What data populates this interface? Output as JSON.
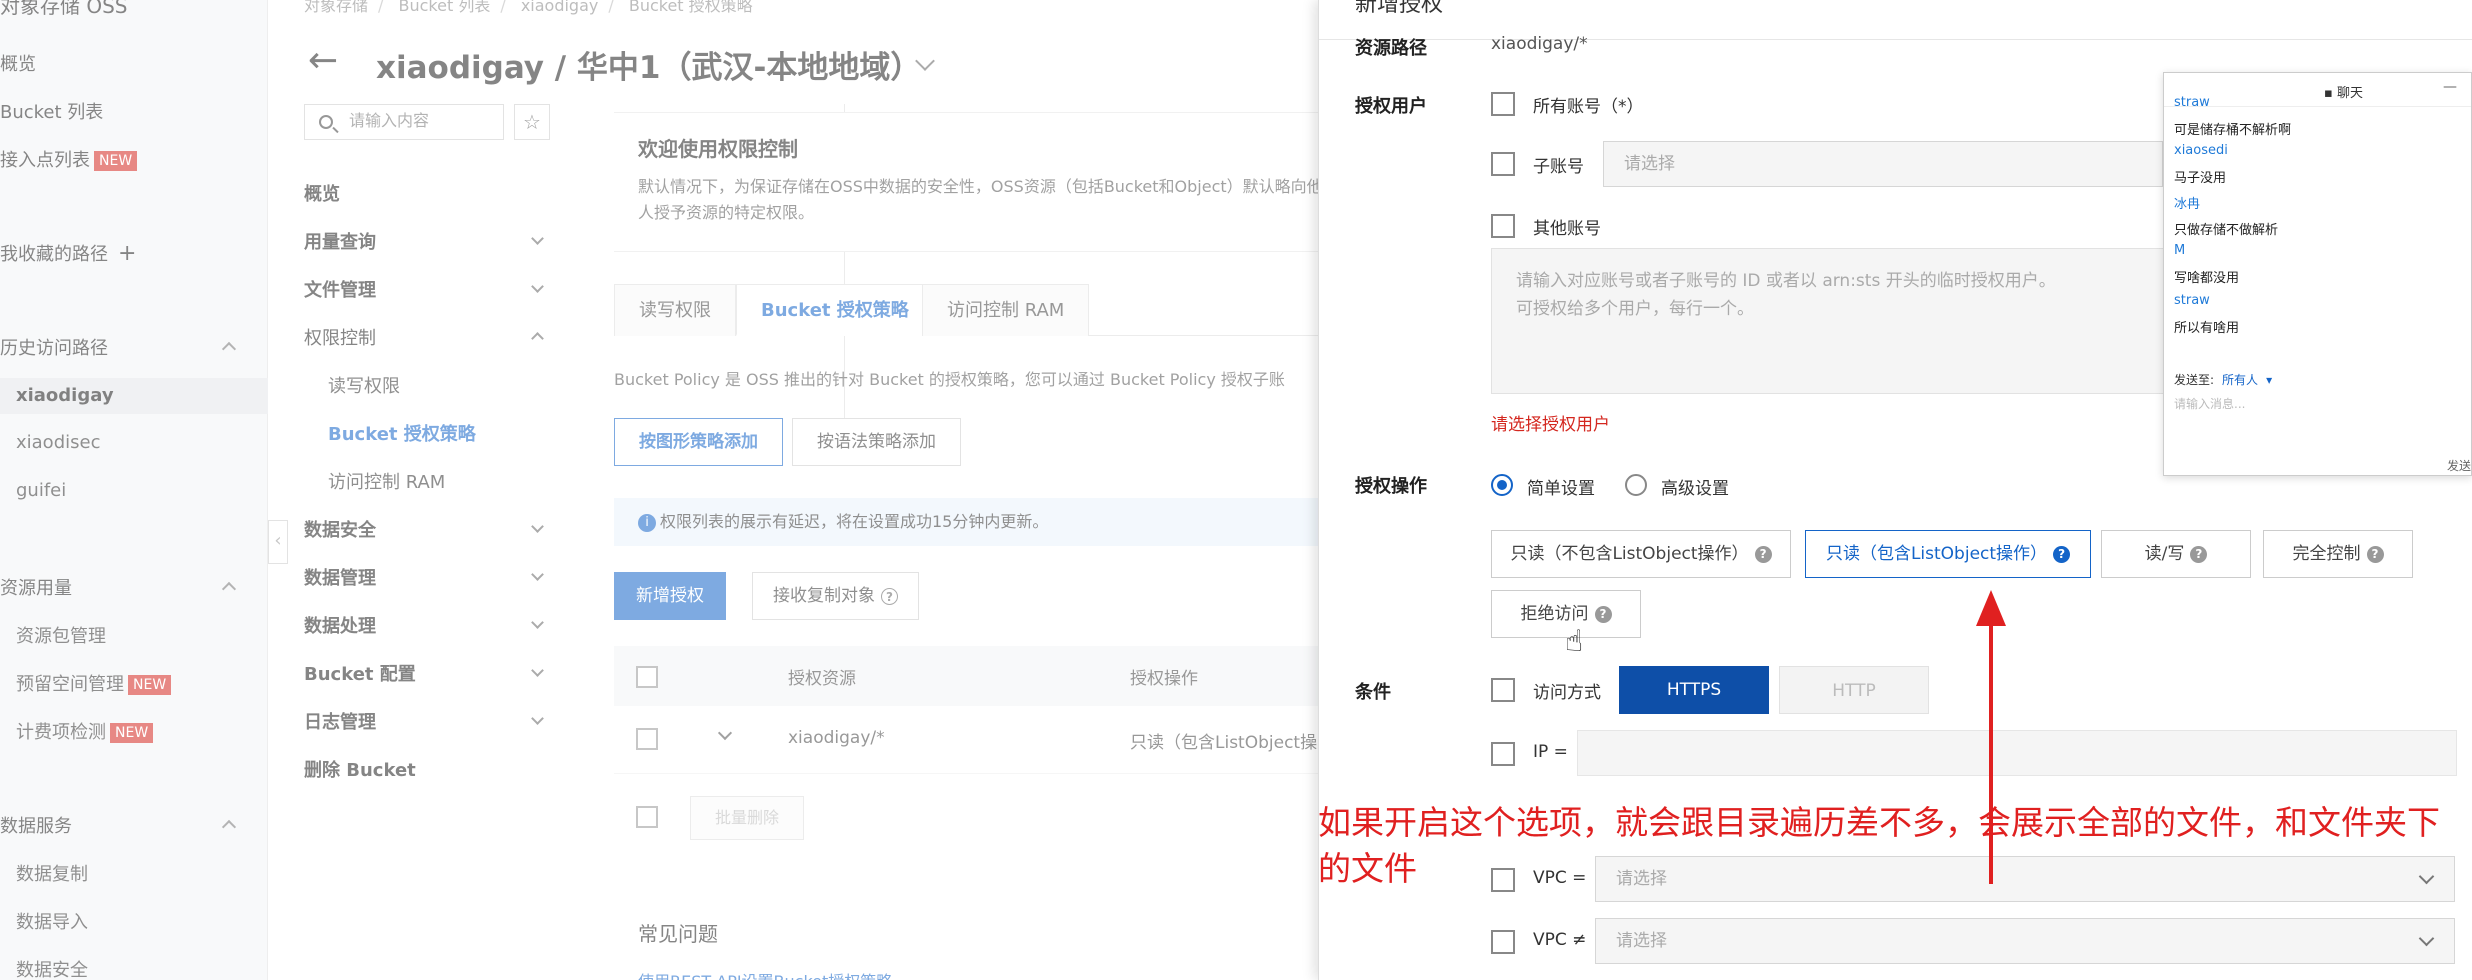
{
  "leftnav": {
    "title": "对象存储 OSS",
    "items": [
      {
        "label": "概览"
      },
      {
        "label": "Bucket 列表"
      },
      {
        "label": "接入点列表",
        "badge": "NEW"
      }
    ],
    "favorites_label": "我收藏的路径",
    "history_section": "历史访问路径",
    "history_items": [
      "xiaodigay",
      "xiaodisec",
      "guifei"
    ],
    "resource_section": "资源用量",
    "resource_items": [
      {
        "label": "资源包管理"
      },
      {
        "label": "预留空间管理",
        "badge": "NEW"
      },
      {
        "label": "计费项检测",
        "badge": "NEW"
      }
    ],
    "data_service_section": "数据服务",
    "data_service_items": [
      "数据复制",
      "数据导入",
      "数据安全"
    ]
  },
  "breadcrumb": [
    "对象存储",
    "Bucket 列表",
    "xiaodigay",
    "Bucket 授权策略"
  ],
  "page_title": "xiaodigay / 华中1（武汉-本地地域）",
  "subnav": {
    "search_placeholder": "请输入内容",
    "items": [
      {
        "label": "概览",
        "chev": false
      },
      {
        "label": "用量查询",
        "chev": true
      },
      {
        "label": "文件管理",
        "chev": true
      },
      {
        "label": "权限控制",
        "chev": true,
        "open": true
      }
    ],
    "perm_sub": [
      "读写权限",
      "Bucket 授权策略",
      "访问控制 RAM"
    ],
    "rest": [
      "数据安全",
      "数据管理",
      "数据处理",
      "Bucket 配置",
      "日志管理",
      "删除 Bucket"
    ]
  },
  "content": {
    "welcome_title": "欢迎使用权限控制",
    "welcome_text": "默认情况下，为保证存储在OSS中数据的安全性，OSS资源（包括Bucket和Object）默认略向他人授予资源的特定权限。",
    "tabs": [
      "读写权限",
      "Bucket 授权策略",
      "访问控制 RAM"
    ],
    "policy_desc": "Bucket Policy 是 OSS 推出的针对 Bucket 的授权策略，您可以通过 Bucket Policy 授权子账",
    "seg_graphic": "按图形策略添加",
    "seg_syntax": "按语法策略添加",
    "info": "权限列表的展示有延迟，将在设置成功15分钟内更新。",
    "btn_add": "新增授权",
    "btn_copy": "接收复制对象",
    "table_headers": [
      "授权资源",
      "授权操作"
    ],
    "rows": [
      {
        "resource": "xiaodigay/*",
        "action": "只读（包含ListObject操"
      }
    ],
    "batch_delete": "批量删除",
    "faq_title": "常见问题",
    "faq_link": "使用REST API设置Bucket授权策略"
  },
  "drawer": {
    "title": "新增授权",
    "resource_path_label": "资源路径",
    "resource_path_value": "xiaodigay/*",
    "auth_user_label": "授权用户",
    "all_accounts": "所有账号（*）",
    "sub_account": "子账号",
    "sub_account_placeholder": "请选择",
    "other_accounts": "其他账号",
    "other_placeholder_1": "请输入对应账号或者子账号的 ID 或者以 arn:sts 开头的临时授权用户。",
    "other_placeholder_2": "可授权给多个用户，每行一个。",
    "error": "请选择授权用户",
    "auth_op_label": "授权操作",
    "simple": "简单设置",
    "advanced": "高级设置",
    "perms": [
      "只读（不包含ListObject操作）",
      "只读（包含ListObject操作）",
      "读/写",
      "完全控制",
      "拒绝访问"
    ],
    "condition_label": "条件",
    "access_method": "访问方式",
    "https": "HTTPS",
    "http": "HTTP",
    "ip_eq": "IP =",
    "vpc_eq": "VPC =",
    "vpc_neq": "VPC ≠",
    "vpc_placeholder": "请选择"
  },
  "annotation": "如果开启这个选项，就会跟目录遍历差不多，会展示全部的文件，和文件夹下的文件",
  "chat": {
    "title": "聊天",
    "lines": [
      {
        "type": "user",
        "text": "straw"
      },
      {
        "type": "msg",
        "text": "可是储存桶不解析啊"
      },
      {
        "type": "user",
        "text": "xiaosedi"
      },
      {
        "type": "msg",
        "text": "马子没用"
      },
      {
        "type": "user",
        "text": "冰冉"
      },
      {
        "type": "msg",
        "text": "只做存储不做解析"
      },
      {
        "type": "user",
        "text": "M"
      },
      {
        "type": "msg",
        "text": "写啥都没用"
      },
      {
        "type": "user",
        "text": "straw"
      },
      {
        "type": "msg",
        "text": "所以有啥用"
      }
    ],
    "send_to_label": "发送至:",
    "send_to_value": "所有人",
    "input_placeholder": "请输入消息...",
    "send_button": "发送"
  },
  "colors": {
    "primary": "#1464c8",
    "annotation": "#e02020",
    "badge_new": "#d4271f"
  }
}
